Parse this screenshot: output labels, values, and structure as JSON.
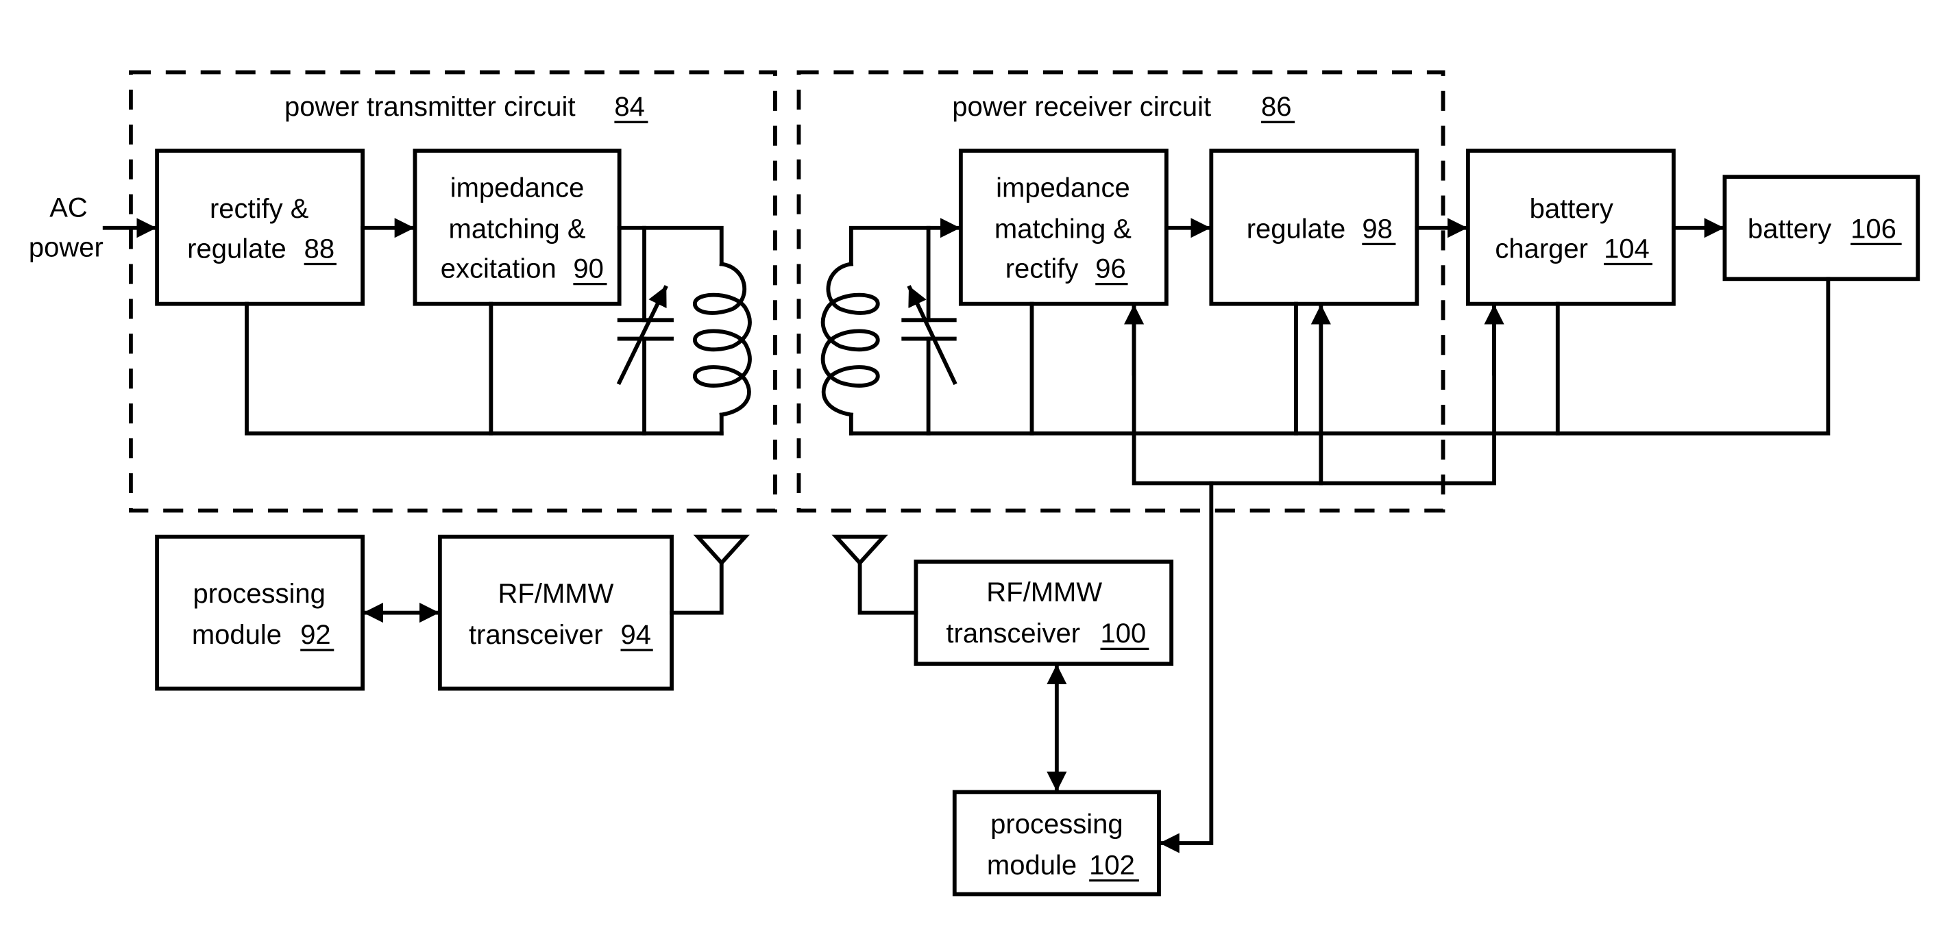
{
  "diagram": {
    "input_label": [
      "AC",
      "power"
    ],
    "groups": {
      "transmitter": {
        "label": "power transmitter circuit",
        "ref": "84"
      },
      "receiver": {
        "label": "power receiver circuit",
        "ref": "86"
      }
    },
    "blocks": {
      "rectify_regulate": {
        "lines": [
          "rectify &",
          "regulate"
        ],
        "ref": "88"
      },
      "imp_excitation": {
        "lines": [
          "impedance",
          "matching &",
          "excitation"
        ],
        "ref": "90"
      },
      "proc_tx": {
        "lines": [
          "processing",
          "module"
        ],
        "ref": "92"
      },
      "rf_tx": {
        "lines": [
          "RF/MMW",
          "transceiver"
        ],
        "ref": "94"
      },
      "imp_rectify": {
        "lines": [
          "impedance",
          "matching &",
          "rectify"
        ],
        "ref": "96"
      },
      "regulate": {
        "lines": [
          "regulate"
        ],
        "ref": "98"
      },
      "rf_rx": {
        "lines": [
          "RF/MMW",
          "transceiver"
        ],
        "ref": "100"
      },
      "proc_rx": {
        "lines": [
          "processing",
          "module"
        ],
        "ref": "102"
      },
      "charger": {
        "lines": [
          "battery",
          "charger"
        ],
        "ref": "104"
      },
      "battery": {
        "lines": [
          "battery"
        ],
        "ref": "106"
      }
    },
    "components": [
      "variable-capacitor-tx",
      "coil-tx",
      "variable-capacitor-rx",
      "coil-rx",
      "antenna-tx",
      "antenna-rx"
    ]
  }
}
